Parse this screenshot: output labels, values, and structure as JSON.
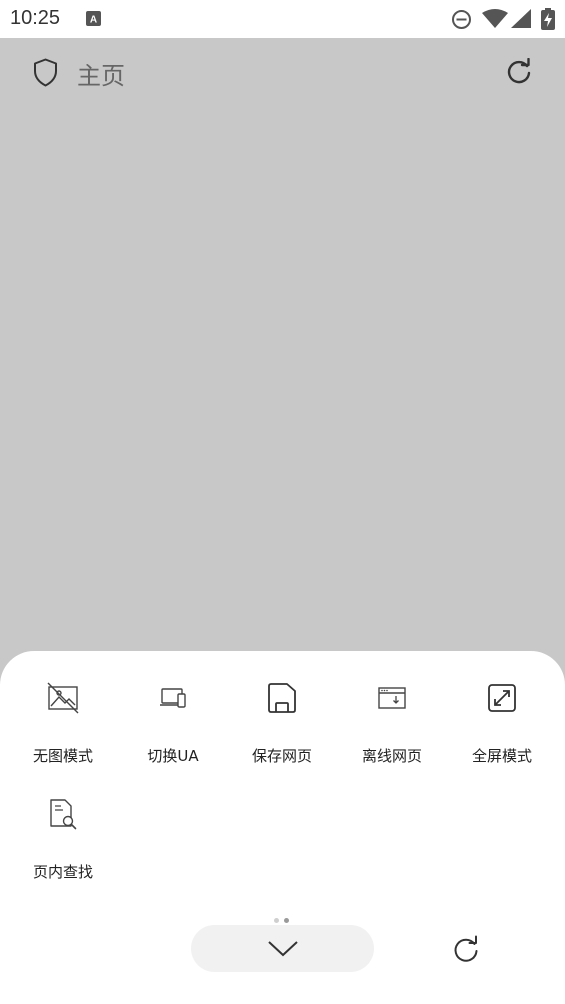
{
  "status_bar": {
    "time": "10:25",
    "icons": [
      "keyboard-a-icon",
      "dnd-icon",
      "wifi-icon",
      "cell-signal-icon",
      "battery-charging-icon"
    ]
  },
  "toolbar": {
    "title": "主页",
    "left_icon": "shield-icon",
    "right_icon": "refresh-icon"
  },
  "menu": {
    "items": [
      {
        "label": "无图模式",
        "icon": "no-image-icon"
      },
      {
        "label": "切换UA",
        "icon": "devices-icon"
      },
      {
        "label": "保存网页",
        "icon": "save-icon"
      },
      {
        "label": "离线网页",
        "icon": "offline-page-icon"
      },
      {
        "label": "全屏模式",
        "icon": "fullscreen-icon"
      },
      {
        "label": "页内查找",
        "icon": "find-in-page-icon"
      }
    ]
  },
  "pager": {
    "pages": 2,
    "current": 2
  },
  "bottom_bar": {
    "collapse_icon": "chevron-down-icon",
    "refresh_icon": "refresh-icon"
  },
  "colors": {
    "content_bg": "#c8c8c8",
    "sheet_bg": "#ffffff",
    "pill_bg": "#f1f1f1",
    "text": "#222222",
    "title_text": "#666666"
  }
}
